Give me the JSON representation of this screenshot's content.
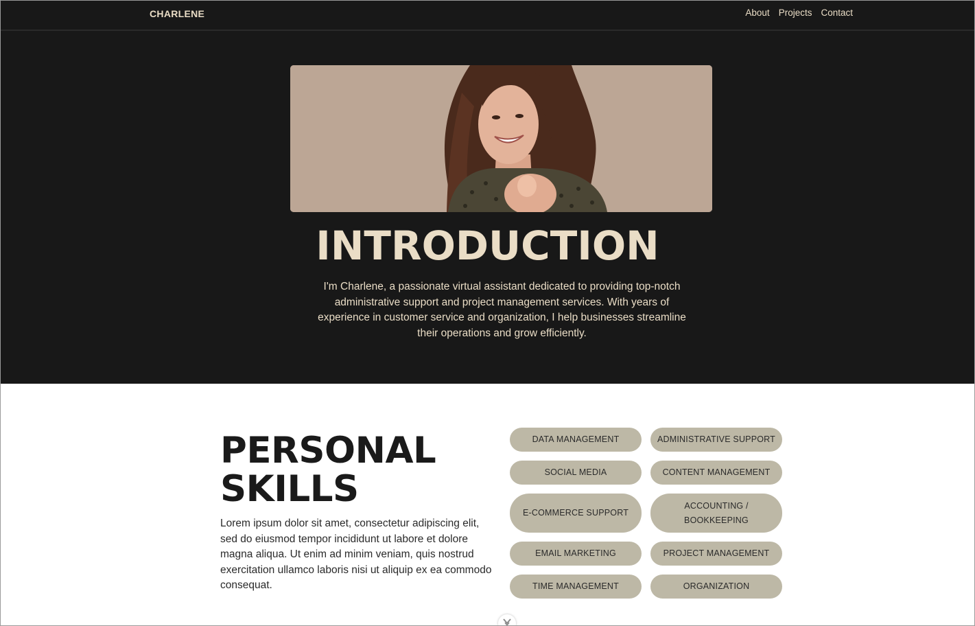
{
  "nav": {
    "brand": "CHARLENE",
    "links": [
      "About",
      "Projects",
      "Contact"
    ]
  },
  "hero": {
    "image_alt": "Smiling woman with long brown hair pointing toward the camera",
    "title": "INTRODUCTION",
    "text": "I'm Charlene, a passionate virtual assistant dedicated to providing top-notch administrative support and project management services. With years of experience in customer service and organization, I help businesses streamline their operations and grow efficiently."
  },
  "skills": {
    "title_line1": "PERSONAL",
    "title_line2": "SKILLS",
    "text": "Lorem ipsum dolor sit amet, consectetur adipiscing elit, sed do eiusmod tempor incididunt ut labore et dolore magna aliqua. Ut enim ad minim veniam, quis nostrud exercitation ullamco laboris nisi ut aliquip ex ea commodo consequat.",
    "pills": [
      "DATA MANAGEMENT",
      "ADMINISTRATIVE SUPPORT",
      "SOCIAL MEDIA",
      "CONTENT MANAGEMENT",
      "E-COMMERCE SUPPORT",
      "ACCOUNTING / BOOKKEEPING",
      "EMAIL MARKETING",
      "PROJECT MANAGEMENT",
      "TIME MANAGEMENT",
      "ORGANIZATION"
    ]
  },
  "colors": {
    "dark_bg": "#181818",
    "cream": "#eaddc6",
    "pill_bg": "#bdb8a6",
    "photo_bg": "#bca695"
  },
  "icons": {
    "scroll": "chevron-down-icon"
  }
}
